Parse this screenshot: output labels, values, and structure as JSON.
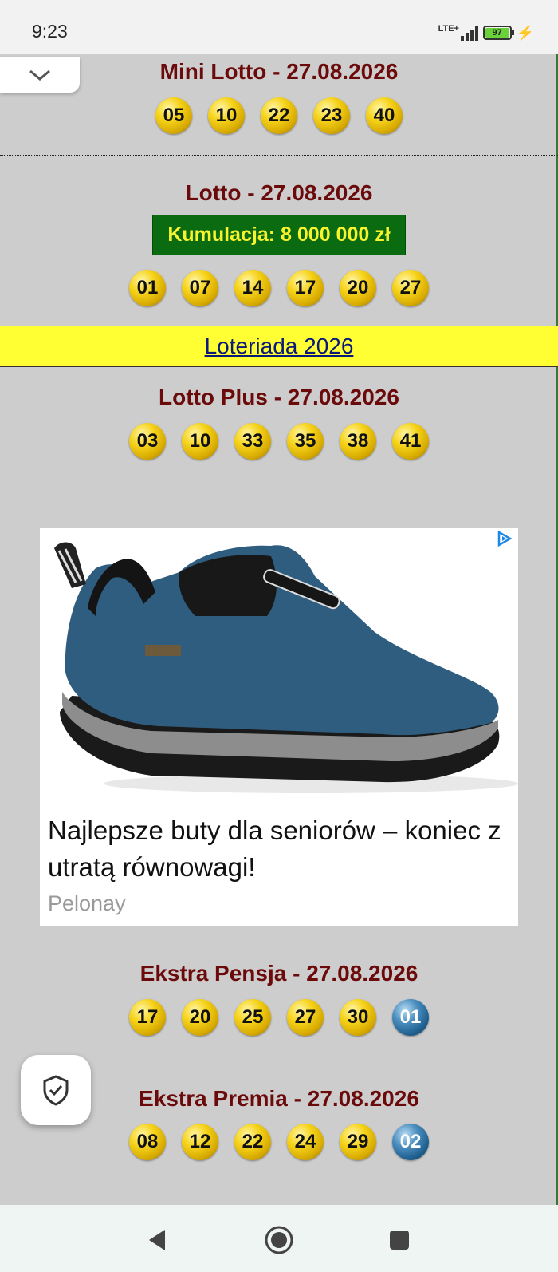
{
  "status": {
    "time": "9:23",
    "network": "LTE+",
    "battery": "97"
  },
  "games": [
    {
      "title": "Mini Lotto - 27.08.2026",
      "numbers": [
        "05",
        "10",
        "22",
        "23",
        "40"
      ]
    },
    {
      "title": "Lotto - 27.08.2026",
      "jackpot": "Kumulacja: 8 000 000 zł",
      "numbers": [
        "01",
        "07",
        "14",
        "17",
        "20",
        "27"
      ]
    },
    {
      "title": "Lotto Plus - 27.08.2026",
      "numbers": [
        "03",
        "10",
        "33",
        "35",
        "38",
        "41"
      ]
    },
    {
      "title": "Ekstra Pensja - 27.08.2026",
      "numbers": [
        "17",
        "20",
        "25",
        "27",
        "30"
      ],
      "extra": "01"
    },
    {
      "title": "Ekstra Premia - 27.08.2026",
      "numbers": [
        "08",
        "12",
        "22",
        "24",
        "29"
      ],
      "extra": "02"
    }
  ],
  "banner": {
    "link": "Loteriada 2026"
  },
  "ad": {
    "headline": "Najlepsze buty dla seniorów – koniec z utratą równowagi!",
    "source": "Pelonay"
  },
  "icons": {
    "collapse": "chevron-down-icon",
    "privacy": "shield-check-icon",
    "ad_choices": "ad-choices-icon",
    "nav": [
      "back-icon",
      "home-icon",
      "recents-icon"
    ]
  },
  "colors": {
    "page_bg": "#cdcdcd",
    "title": "#6b0a0a",
    "jackpot_bg": "#0b6b10",
    "jackpot_text": "#f7f32e",
    "banner_bg": "#ffff33",
    "ball_gold": "#f6d31a",
    "ball_blue": "#1f5f8e"
  }
}
